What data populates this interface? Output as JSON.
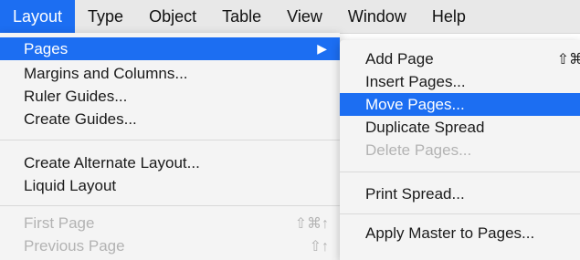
{
  "menubar": {
    "items": [
      "Layout",
      "Type",
      "Object",
      "Table",
      "View",
      "Window",
      "Help"
    ],
    "active_index": 0
  },
  "layout_menu": {
    "pages": "Pages",
    "margins_columns": "Margins and Columns...",
    "ruler_guides": "Ruler Guides...",
    "create_guides": "Create Guides...",
    "create_alternate_layout": "Create Alternate Layout...",
    "liquid_layout": "Liquid Layout",
    "first_page": "First Page",
    "first_page_shortcut": "⇧⌘↑",
    "previous_page": "Previous Page",
    "previous_page_shortcut": "⇧↑"
  },
  "pages_submenu": {
    "add_page": "Add Page",
    "add_page_shortcut": "⇧⌘",
    "insert_pages": "Insert Pages...",
    "move_pages": "Move Pages...",
    "duplicate_spread": "Duplicate Spread",
    "delete_pages": "Delete Pages...",
    "print_spread": "Print Spread...",
    "apply_master": "Apply Master to Pages..."
  },
  "colors": {
    "highlight": "#1c6ef2",
    "menu_bg": "#f4f4f4",
    "disabled_text": "#b3b3b3"
  },
  "icons": {
    "submenu_arrow": "▶"
  }
}
